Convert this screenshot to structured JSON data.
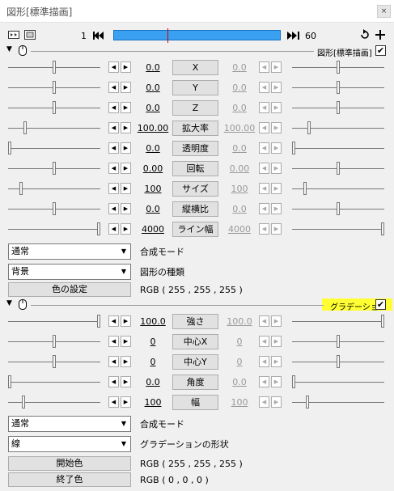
{
  "window": {
    "title": "図形[標準描画]",
    "close": "×"
  },
  "toolbar": {
    "frame_start": "1",
    "frame_end": "60"
  },
  "section1": {
    "header_label": "図形[標準描画]",
    "enabled": true,
    "params": [
      {
        "name": "X",
        "left": "0.0",
        "right": "0.0",
        "lfrac": 0.5,
        "rfrac": 0.5
      },
      {
        "name": "Y",
        "left": "0.0",
        "right": "0.0",
        "lfrac": 0.5,
        "rfrac": 0.5
      },
      {
        "name": "Z",
        "left": "0.0",
        "right": "0.0",
        "lfrac": 0.5,
        "rfrac": 0.5
      },
      {
        "name": "拡大率",
        "left": "100.00",
        "right": "100.00",
        "lfrac": 0.17,
        "rfrac": 0.17
      },
      {
        "name": "透明度",
        "left": "0.0",
        "right": "0.0",
        "lfrac": 0.0,
        "rfrac": 0.0
      },
      {
        "name": "回転",
        "left": "0.00",
        "right": "0.00",
        "lfrac": 0.5,
        "rfrac": 0.5
      },
      {
        "name": "サイズ",
        "left": "100",
        "right": "100",
        "lfrac": 0.13,
        "rfrac": 0.13
      },
      {
        "name": "縦横比",
        "left": "0.0",
        "right": "0.0",
        "lfrac": 0.5,
        "rfrac": 0.5
      },
      {
        "name": "ライン幅",
        "left": "4000",
        "right": "4000",
        "lfrac": 1.0,
        "rfrac": 1.0
      }
    ],
    "blend_mode": "通常",
    "blend_label": "合成モード",
    "shape_type": "背景",
    "shape_label": "図形の種類",
    "color_button": "色の設定",
    "color_value": "RGB ( 255 , 255 , 255 )"
  },
  "section2": {
    "header_label": "グラデーション",
    "enabled": true,
    "params": [
      {
        "name": "強さ",
        "left": "100.0",
        "right": "100.0",
        "lfrac": 1.0,
        "rfrac": 1.0
      },
      {
        "name": "中心X",
        "left": "0",
        "right": "0",
        "lfrac": 0.5,
        "rfrac": 0.5
      },
      {
        "name": "中心Y",
        "left": "0",
        "right": "0",
        "lfrac": 0.5,
        "rfrac": 0.5
      },
      {
        "name": "角度",
        "left": "0.0",
        "right": "0.0",
        "lfrac": 0.0,
        "rfrac": 0.0
      },
      {
        "name": "幅",
        "left": "100",
        "right": "100",
        "lfrac": 0.15,
        "rfrac": 0.15
      }
    ],
    "blend_mode": "通常",
    "blend_label": "合成モード",
    "shape": "線",
    "shape_label": "グラデーションの形状",
    "start_button": "開始色",
    "start_value": "RGB ( 255 , 255 , 255 )",
    "end_button": "終了色",
    "end_value": "RGB ( 0 , 0 , 0 )"
  },
  "icons": {
    "left_arrow": "◀",
    "right_arrow": "▶",
    "dropdown": "▼",
    "collapse": "▼",
    "check": "✔"
  },
  "colors": {
    "timeline": "#3aa0f2",
    "highlight": "#ffff33"
  }
}
